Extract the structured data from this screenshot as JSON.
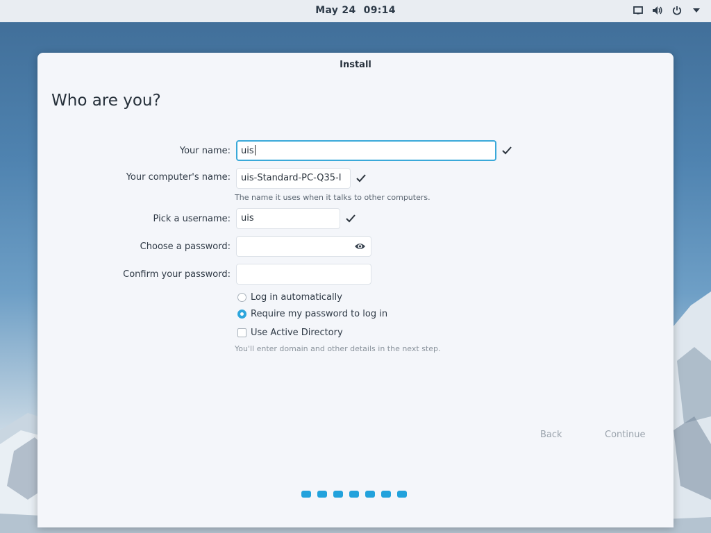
{
  "topbar": {
    "date": "May 24",
    "time": "09:14",
    "icons": [
      "screen-icon",
      "volume-icon",
      "power-icon",
      "dropdown-arrow-icon"
    ]
  },
  "window": {
    "title": "Install",
    "heading": "Who are you?"
  },
  "form": {
    "name_label": "Your name:",
    "name_value": "uis",
    "computer_label": "Your computer's name:",
    "computer_value": "uis-Standard-PC-Q35-I",
    "computer_hint": "The name it uses when it talks to other computers.",
    "username_label": "Pick a username:",
    "username_value": "uis",
    "password_label": "Choose a password:",
    "password_value": "",
    "confirm_label": "Confirm your password:",
    "confirm_value": "",
    "login_auto": "Log in automatically",
    "login_require": "Require my password to log in",
    "active_directory": "Use Active Directory",
    "ad_hint": "You'll enter domain and other details in the next step.",
    "selected_login_option": "Require my password to log in",
    "active_directory_checked": false
  },
  "buttons": {
    "back": "Back",
    "continue": "Continue"
  },
  "progress": {
    "steps": 7
  },
  "colors": {
    "accent": "#22a2dc",
    "focus_border": "#3aa9d9",
    "window_bg": "#f4f6fa"
  }
}
